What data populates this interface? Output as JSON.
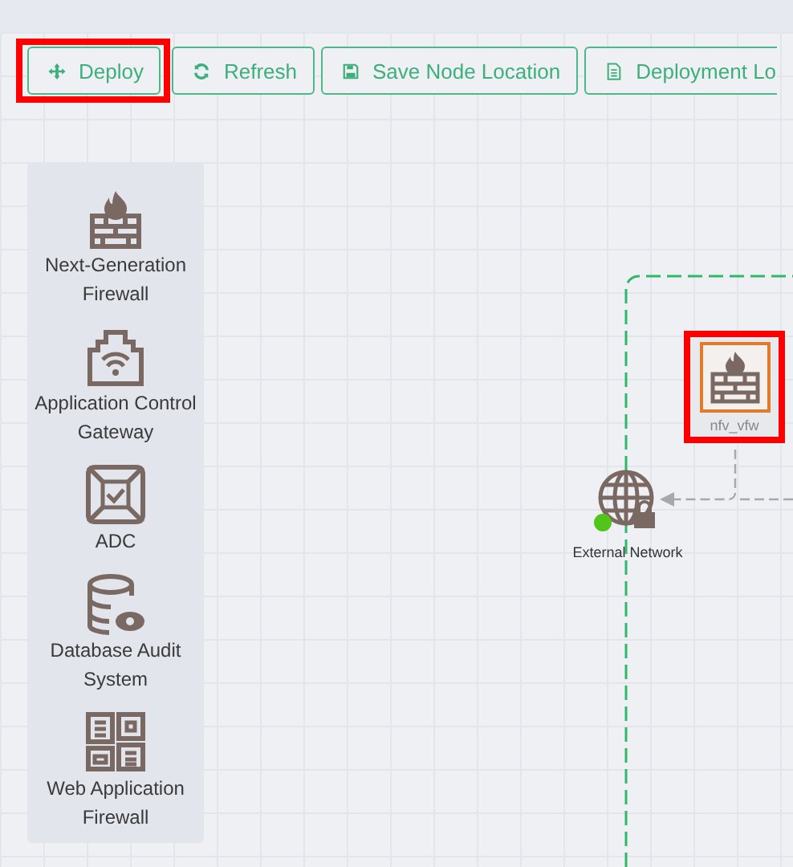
{
  "toolbar": {
    "buttons": [
      {
        "label": "Deploy",
        "kind": "move",
        "highlighted": true
      },
      {
        "label": "Refresh",
        "kind": "refresh",
        "highlighted": false
      },
      {
        "label": "Save Node Location",
        "kind": "save",
        "highlighted": false
      },
      {
        "label": "Deployment Lo",
        "kind": "document",
        "highlighted": false
      }
    ]
  },
  "palette": {
    "items": [
      {
        "label": "Next-Generation Firewall",
        "kind": "firewall"
      },
      {
        "label": "Application Control Gateway",
        "kind": "gateway"
      },
      {
        "label": "ADC",
        "kind": "adc"
      },
      {
        "label": "Database Audit System",
        "kind": "database"
      },
      {
        "label": "Web Application Firewall",
        "kind": "waf"
      }
    ]
  },
  "canvas": {
    "nodes": [
      {
        "label": "nfv_vfw",
        "kind": "firewall",
        "highlighted": true
      },
      {
        "label": "External Network",
        "kind": "network",
        "color": "#52c41a"
      }
    ]
  }
}
